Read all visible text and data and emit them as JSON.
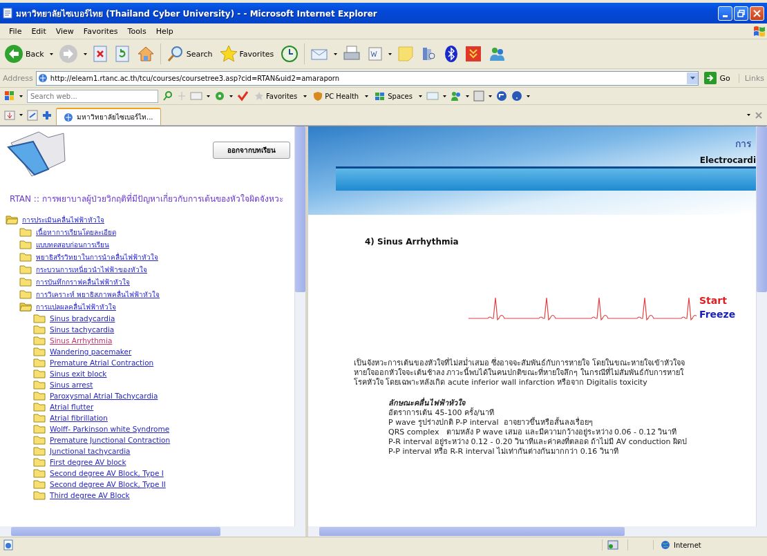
{
  "window": {
    "title": "มหาวิทยาลัยไซเบอร์ไทย (Thailand Cyber University) - - Microsoft Internet Explorer"
  },
  "menu_bar": [
    "File",
    "Edit",
    "View",
    "Favorites",
    "Tools",
    "Help"
  ],
  "toolbar": {
    "back": "Back",
    "search": "Search",
    "favorites": "Favorites"
  },
  "address_bar": {
    "label": "Address",
    "url": "http://elearn1.rtanc.ac.th/tcu/courses/coursetree3.asp?cid=RTAN&uid2=amaraporn",
    "go": "Go",
    "links": "Links"
  },
  "search_toolbar": {
    "placeholder": "Search web...",
    "items": [
      "Favorites",
      "PC Health",
      "Spaces"
    ]
  },
  "tabs": [
    {
      "label": "มหาวิทยาลัยไซเบอร์ไท...",
      "selected": true
    }
  ],
  "left_frame": {
    "exit_button": "ออกจากบทเรียน",
    "course_title": "RTAN :: การพยาบาลผู้ป่วยวิกฤติที่มีปัญหาเกี่ยวกับการเต้นของหัวใจผิดจังหวะ",
    "tree": [
      {
        "label": "การประเมินคลื่นไฟฟ้าหัวใจ",
        "expanded": true,
        "children": [
          {
            "label": "เนื้อหาการเรียนโดยละเอียด",
            "expanded": false
          },
          {
            "label": "แบบทดสอบก่อนการเรียน",
            "expanded": false
          },
          {
            "label": "พยาธิสรีรวิทยาในการนำคลื่นไฟฟ้าหัวใจ",
            "expanded": false
          },
          {
            "label": "กระบวนการเหนี่ยวนำไฟฟ้าของหัวใจ",
            "expanded": false
          },
          {
            "label": "การบันทึกกราฟคลื่นไฟฟ้าหัวใจ",
            "expanded": false
          },
          {
            "label": "การวิเคราะห์ พยาธิสภาพคลื่นไฟฟ้าหัวใจ",
            "expanded": false
          },
          {
            "label": "การแปลผลคลื่นไฟฟ้าหัวใจ",
            "expanded": true,
            "children": [
              {
                "label": "Sinus bradycardia",
                "selected": false
              },
              {
                "label": "Sinus tachycardia",
                "selected": false
              },
              {
                "label": "Sinus Arrhythmia",
                "selected": true
              },
              {
                "label": "Wandering pacemaker",
                "selected": false
              },
              {
                "label": "Premature Atrial Contraction",
                "selected": false
              },
              {
                "label": "Sinus exit block",
                "selected": false
              },
              {
                "label": "Sinus arrest",
                "selected": false
              },
              {
                "label": "Paroxysmal Atrial Tachycardia",
                "selected": false
              },
              {
                "label": "Atrial flutter",
                "selected": false
              },
              {
                "label": "Atrial fibrillation",
                "selected": false
              },
              {
                "label": "Wolff- Parkinson white Syndrome",
                "selected": false
              },
              {
                "label": "Premature Junctional Contraction",
                "selected": false
              },
              {
                "label": "Junctional tachycardia",
                "selected": false
              },
              {
                "label": "First degree AV block",
                "selected": false
              },
              {
                "label": "Second degree AV Block, Type I",
                "selected": false
              },
              {
                "label": "Second degree AV Block, Type II",
                "selected": false
              },
              {
                "label": "Third degree AV Block",
                "selected": false
              }
            ]
          }
        ]
      }
    ]
  },
  "lesson": {
    "banner_title": "การ",
    "banner_subtitle": "Electrocardi",
    "heading": "4) Sinus Arrhythmia",
    "ecg_controls": [
      {
        "label": "Start",
        "color": "#e02020"
      },
      {
        "label": "Freeze",
        "color": "#1a22b8"
      }
    ],
    "description_lines": [
      "เป็นจังหวะการเต้นของหัวใจที่ไม่สม่ำเสมอ ซึ่งอาจจะสัมพันธ์กับการหายใจ โดยในขณะหายใจเข้าหัวใจจ",
      "หายใจออกหัวใจจะเต้นช้าลง ภาวะนี้พบได้ในคนปกติขณะที่หายใจลึกๆ ในกรณีที่ไม่สัมพันธ์กับการหายใ",
      "โรคหัวใจ โดยเฉพาะหลังเกิด acute inferior wall infarction หรือจาก Digitalis toxicity"
    ],
    "characteristics": {
      "title": "ลักษณะคลื่นไฟฟ้าหัวใจ",
      "lines": [
        "อัตราการเต้น 45-100 ครั้ง/นาที",
        "P wave รูปร่างปกติ P-P interval  อาจยาวขึ้นหรือสั้นลงเรื่อยๆ",
        "QRS complex   ตามหลัง P wave เสมอ และมีความกว้างอยู่ระหว่าง 0.06 - 0.12 วินาที",
        "P-R interval อยู่ระหว่าง 0.12 - 0.20 วินาทีและค่าคงที่ตลอด ถ้าไม่มี AV conduction ผิดป",
        "P-P interval หรือ R-R interval ไม่เท่ากันต่างกันมากกว่า 0.16 วินาที"
      ]
    }
  },
  "status_bar": {
    "zone": "Internet"
  }
}
